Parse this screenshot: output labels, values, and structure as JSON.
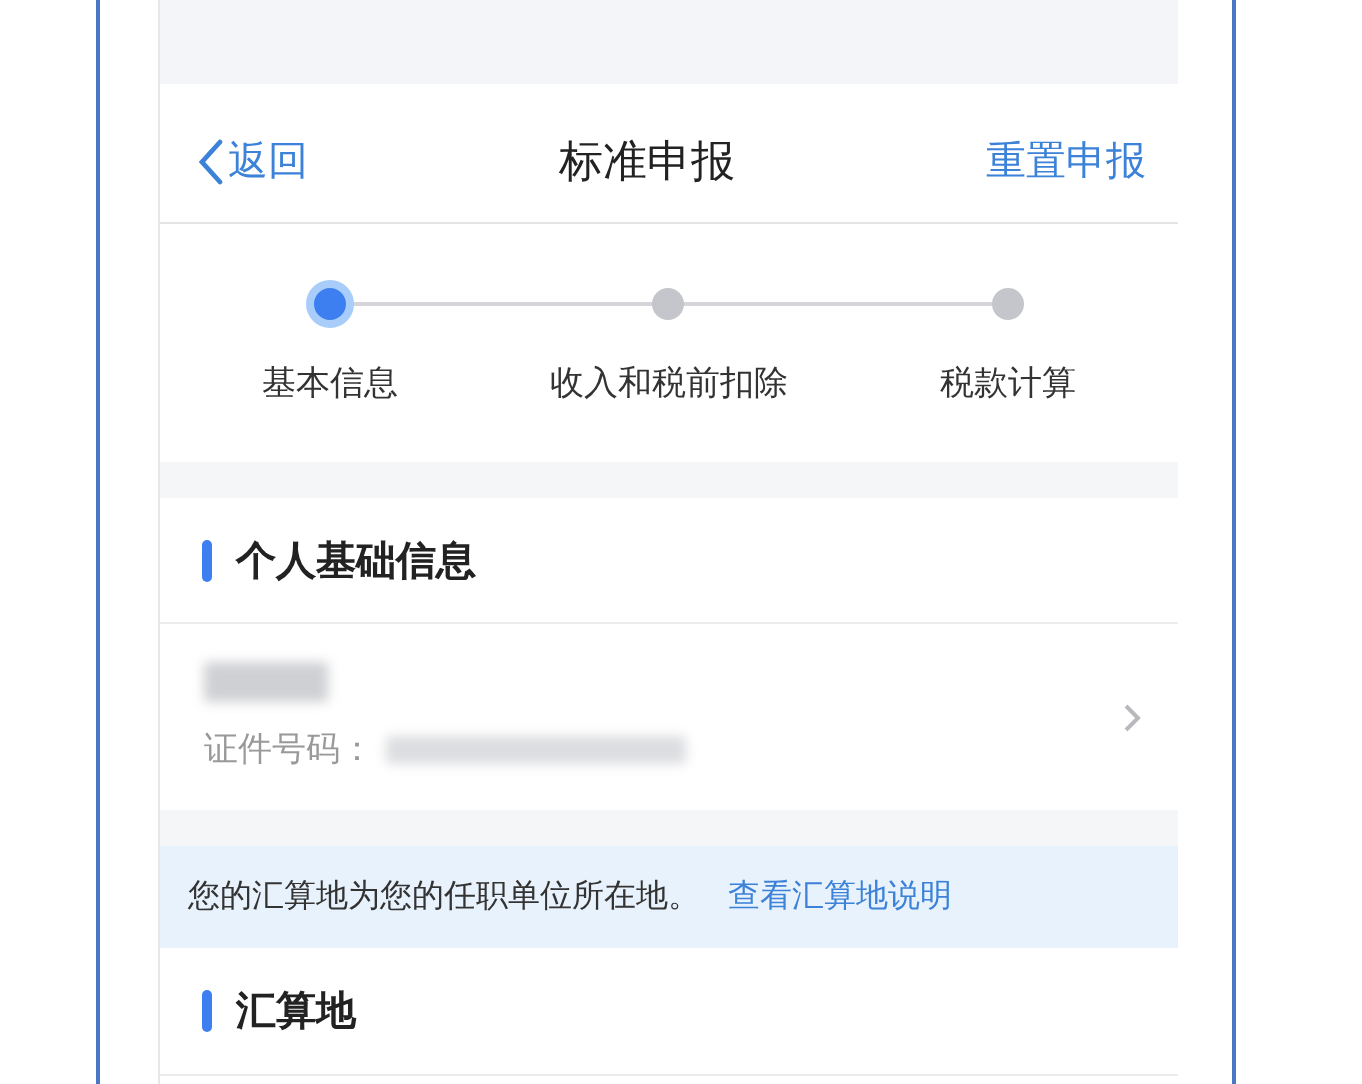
{
  "nav": {
    "back": "返回",
    "title": "标准申报",
    "action": "重置申报"
  },
  "steps": [
    {
      "label": "基本信息",
      "selected": true
    },
    {
      "label": "收入和税前扣除",
      "selected": false
    },
    {
      "label": "税款计算",
      "selected": false
    }
  ],
  "sections": [
    {
      "kind": "header",
      "title": "个人基础信息"
    },
    {
      "kind": "person",
      "id_label": "证件号码："
    },
    {
      "kind": "notice",
      "text": "您的汇算地为您的任职单位所在地。",
      "link": "查看汇算地说明"
    },
    {
      "kind": "header",
      "title": "汇算地"
    }
  ]
}
